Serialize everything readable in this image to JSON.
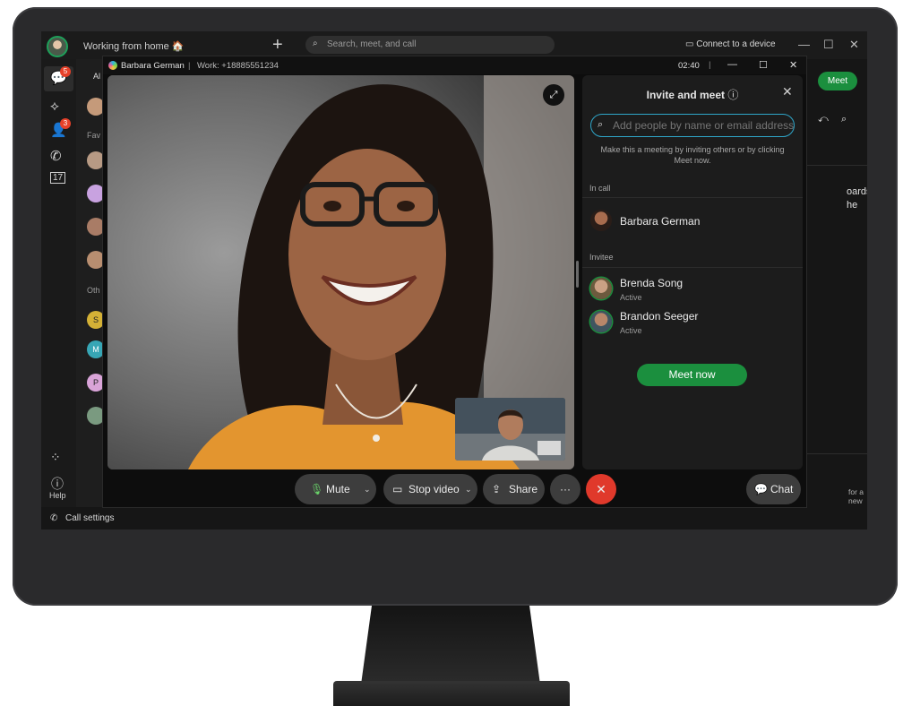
{
  "app": {
    "status": "Working from home 🏠",
    "search_placeholder": "Search, meet, and call",
    "connect": "Connect to a device",
    "bottom_bar": "Call settings",
    "meet_label": "Meet",
    "help_label": "Help",
    "list_labels": {
      "tab_all": "Al",
      "favorites": "Fav",
      "others": "Oth"
    },
    "list_initials": [
      "S",
      "M",
      "P"
    ],
    "right_pane_text": [
      "oards,",
      "he"
    ],
    "right_pane_hint": "for a new line",
    "badges": {
      "messages": "5",
      "contacts": "3"
    },
    "calendar_day": "17"
  },
  "call": {
    "caller": "Barbara German",
    "work_number": "Work: +18885551234",
    "timer": "02:40"
  },
  "invite_panel": {
    "title": "Invite and meet",
    "input_placeholder": "Add people by name or email address",
    "hint": "Make this a meeting by inviting others or by clicking Meet now.",
    "in_call_label": "In call",
    "in_call": [
      {
        "name": "Barbara German"
      }
    ],
    "invitee_label": "Invitee",
    "invitees": [
      {
        "name": "Brenda Song",
        "status": "Active"
      },
      {
        "name": "Brandon Seeger",
        "status": "Active"
      }
    ],
    "meet_now": "Meet now"
  },
  "controls": {
    "mute": "Mute",
    "stop_video": "Stop video",
    "share": "Share",
    "more": "···",
    "chat": "Chat"
  },
  "colors": {
    "accent_green": "#1b8f3e",
    "end_call_red": "#e0392b",
    "input_focus": "#2fa6c9"
  }
}
